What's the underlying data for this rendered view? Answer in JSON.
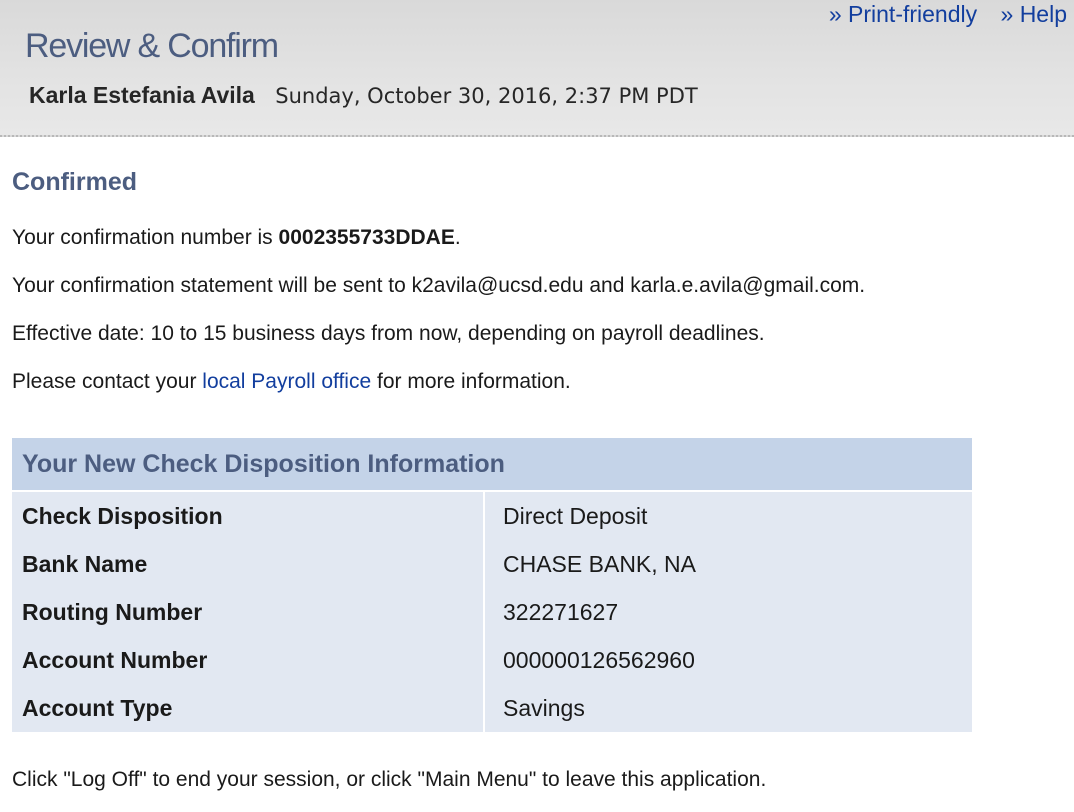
{
  "header": {
    "links": {
      "print_friendly": "» Print-friendly",
      "help": "» Help"
    },
    "title": "Review & Confirm",
    "user_name": "Karla Estefania Avila",
    "timestamp": "Sunday, October 30, 2016, 2:37 PM PDT"
  },
  "confirmation": {
    "heading": "Confirmed",
    "number_prefix": "Your confirmation number is ",
    "number": "0002355733DDAE",
    "number_suffix": ".",
    "statement_line": "Your confirmation statement will be sent to k2avila@ucsd.edu and karla.e.avila@gmail.com.",
    "effective_date_line": "Effective date: 10 to 15 business days from now, depending on payroll deadlines.",
    "contact_prefix": "Please contact your ",
    "contact_link": "local Payroll office",
    "contact_suffix": " for more information."
  },
  "disposition_table": {
    "heading": "Your New Check Disposition Information",
    "rows": [
      {
        "label": "Check Disposition",
        "value": "Direct Deposit"
      },
      {
        "label": "Bank Name",
        "value": "CHASE BANK, NA"
      },
      {
        "label": "Routing Number",
        "value": "322271627"
      },
      {
        "label": "Account Number",
        "value": "000000126562960"
      },
      {
        "label": "Account Type",
        "value": "Savings"
      }
    ]
  },
  "footer_note": "Click \"Log Off\" to end your session, or click \"Main Menu\" to leave this application.",
  "colors": {
    "link": "#123e9e",
    "heading": "#4c5d80",
    "table_header_bg": "#c4d3e8",
    "table_body_bg": "#e2e8f2"
  }
}
